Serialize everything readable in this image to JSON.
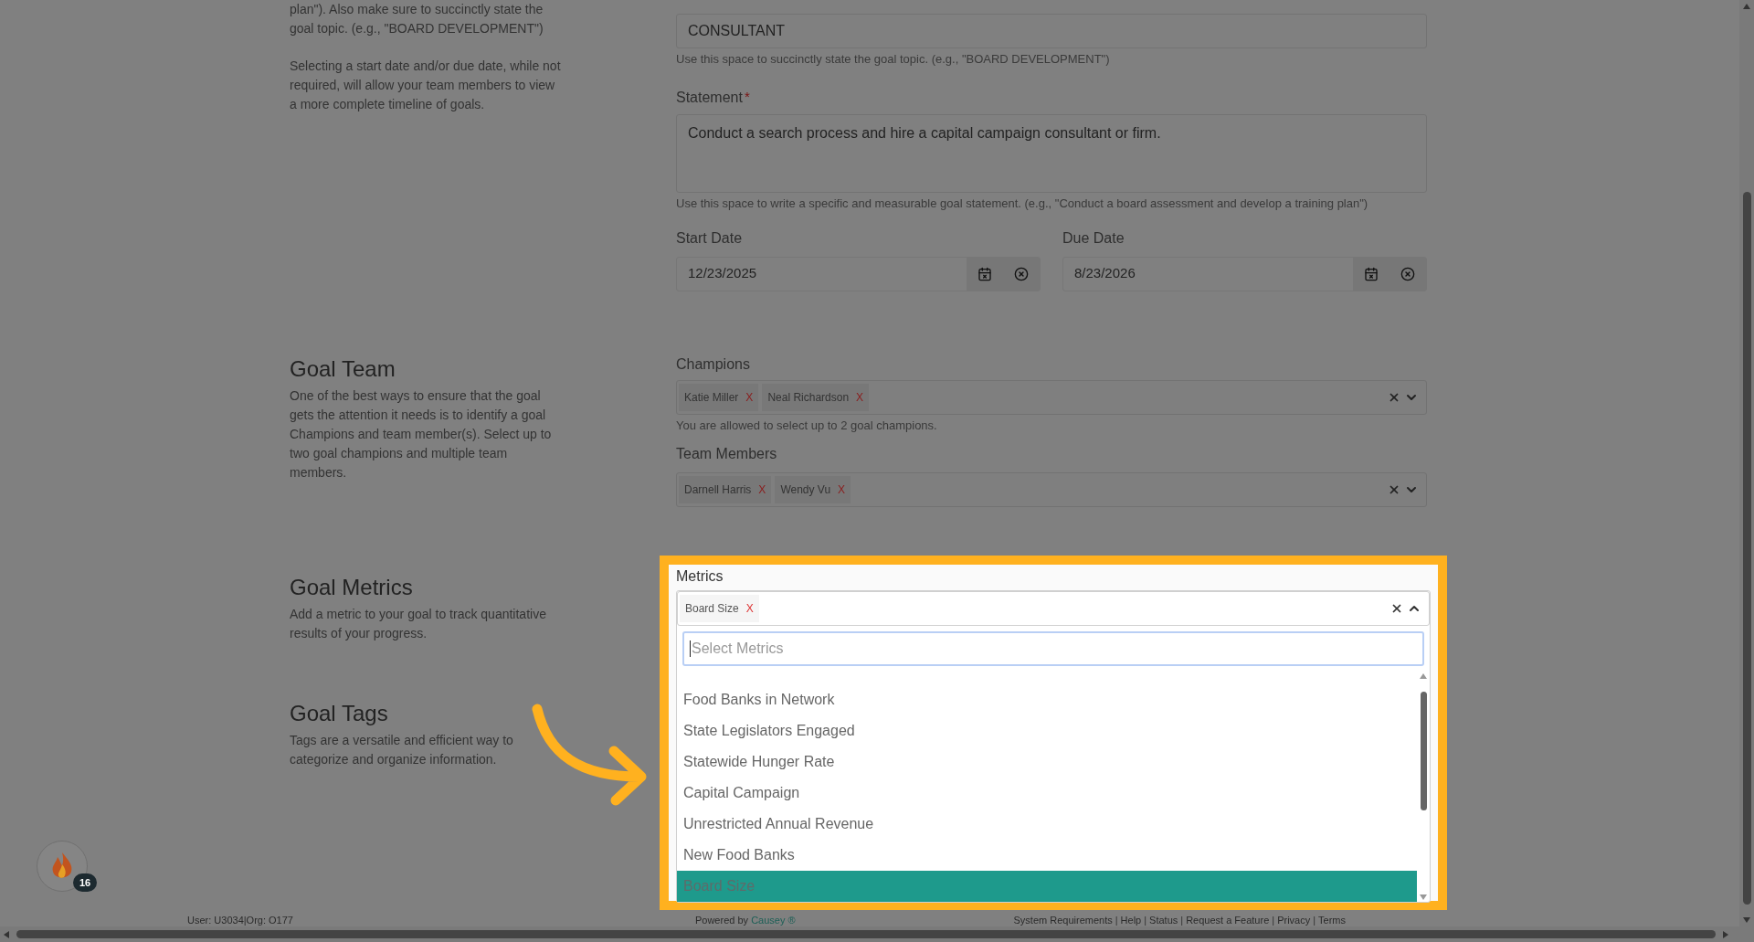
{
  "intro": {
    "texts": [
      "plan\"). Also make sure to succinctly state the goal topic. (e.g., \"BOARD DEVELOPMENT\")",
      "Selecting a start date and/or due date, while not required, will allow your team members to view a more complete timeline of goals."
    ]
  },
  "topic": {
    "value": "CONSULTANT",
    "help": "Use this space to succinctly state the goal topic. (e.g., \"BOARD DEVELOPMENT\")"
  },
  "statement": {
    "label": "Statement",
    "required_mark": "*",
    "value": "Conduct a search process and hire a capital campaign consultant or firm.",
    "help": "Use this space to write a specific and measurable goal statement. (e.g., \"Conduct a board assessment and develop a training plan\")"
  },
  "dates": [
    {
      "label": "Start Date",
      "value": "12/23/2025"
    },
    {
      "label": "Due Date",
      "value": "8/23/2026"
    }
  ],
  "goal_team": {
    "title": "Goal Team",
    "description": "One of the best ways to ensure that the goal gets the attention it needs is to identify a goal Champions and team member(s). Select up to two goal champions and multiple team members."
  },
  "champions": {
    "label": "Champions",
    "chips": [
      {
        "label": "Katie Miller",
        "remove": "X"
      },
      {
        "label": "Neal Richardson",
        "remove": "X"
      }
    ],
    "help": "You are allowed to select up to 2 goal champions."
  },
  "team_members": {
    "label": "Team Members",
    "chips": [
      {
        "label": "Darnell Harris",
        "remove": "X"
      },
      {
        "label": "Wendy Vu",
        "remove": "X"
      }
    ]
  },
  "goal_metrics": {
    "title": "Goal Metrics",
    "description": "Add a metric to your goal to track quantitative results of your progress."
  },
  "goal_tags": {
    "title": "Goal Tags",
    "description": "Tags are a versatile and efficient way to categorize and organize information."
  },
  "metrics": {
    "label": "Metrics",
    "expanded": true,
    "chips": [
      {
        "label": "Board Size",
        "remove": "X"
      }
    ],
    "search_placeholder": "Select Metrics",
    "options": [
      {
        "label": "Food Banks in Network",
        "selected": false
      },
      {
        "label": "State Legislators Engaged",
        "selected": false
      },
      {
        "label": "Statewide Hunger Rate",
        "selected": false
      },
      {
        "label": "Capital Campaign",
        "selected": false
      },
      {
        "label": "Unrestricted Annual Revenue",
        "selected": false
      },
      {
        "label": "New Food Banks",
        "selected": false
      },
      {
        "label": "Board Size",
        "selected": true
      }
    ]
  },
  "notification_badge": "16",
  "footer": {
    "user": "User: U3034|Org: O177",
    "powered_by": "Powered by",
    "brand": "Causey ®",
    "links": [
      "System Requirements",
      "Help",
      "Status",
      "Request a Feature",
      "Privacy",
      "Terms"
    ],
    "separator": "|"
  }
}
